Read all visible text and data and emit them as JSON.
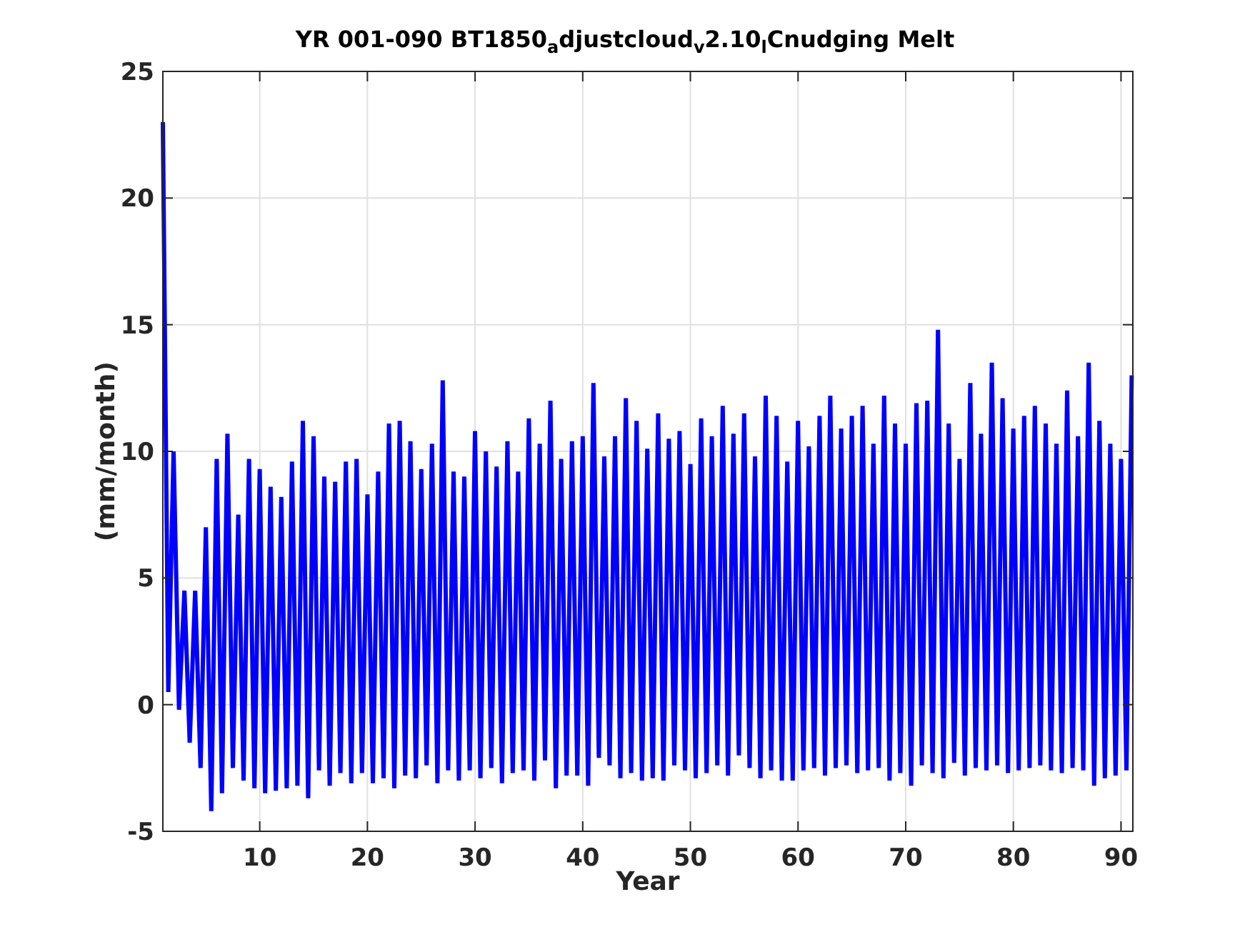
{
  "figure": {
    "chart_data": {
      "type": "line",
      "title": "YR 001-090 BT1850$_{a}$djustcloud$_{v}$2.10$_{l}$Cnudging Melt",
      "xlabel": "Year",
      "ylabel": "(mm/month)",
      "xlim": [
        1,
        91.1
      ],
      "ylim": [
        -5,
        25
      ],
      "xticks": [
        10,
        20,
        30,
        40,
        50,
        60,
        70,
        80,
        90
      ],
      "yticks": [
        25,
        20,
        15,
        10,
        5,
        0,
        -5
      ],
      "grid": true,
      "x": [
        1,
        1.5,
        2,
        2.5,
        3,
        3.5,
        4,
        4.5,
        5,
        5.5,
        6,
        6.5,
        7,
        7.5,
        8,
        8.5,
        9,
        9.5,
        10,
        10.5,
        11,
        11.5,
        12,
        12.5,
        13,
        13.5,
        14,
        14.5,
        15,
        15.5,
        16,
        16.5,
        17,
        17.5,
        18,
        18.5,
        19,
        19.5,
        20,
        20.5,
        21,
        21.5,
        22,
        22.5,
        23,
        23.5,
        24,
        24.5,
        25,
        25.5,
        26,
        26.5,
        27,
        27.5,
        28,
        28.5,
        29,
        29.5,
        30,
        30.5,
        31,
        31.5,
        32,
        32.5,
        33,
        33.5,
        34,
        34.5,
        35,
        35.5,
        36,
        36.5,
        37,
        37.5,
        38,
        38.5,
        39,
        39.5,
        40,
        40.5,
        41,
        41.5,
        42,
        42.5,
        43,
        43.5,
        44,
        44.5,
        45,
        45.5,
        46,
        46.5,
        47,
        47.5,
        48,
        48.5,
        49,
        49.5,
        50,
        50.5,
        51,
        51.5,
        52,
        52.5,
        53,
        53.5,
        54,
        54.5,
        55,
        55.5,
        56,
        56.5,
        57,
        57.5,
        58,
        58.5,
        59,
        59.5,
        60,
        60.5,
        61,
        61.5,
        62,
        62.5,
        63,
        63.5,
        64,
        64.5,
        65,
        65.5,
        66,
        66.5,
        67,
        67.5,
        68,
        68.5,
        69,
        69.5,
        70,
        70.5,
        71,
        71.5,
        72,
        72.5,
        73,
        73.5,
        74,
        74.5,
        75,
        75.5,
        76,
        76.5,
        77,
        77.5,
        78,
        78.5,
        79,
        79.5,
        80,
        80.5,
        81,
        81.5,
        82,
        82.5,
        83,
        83.5,
        84,
        84.5,
        85,
        85.5,
        86,
        86.5,
        87,
        87.5,
        88,
        88.5,
        89,
        89.5,
        90,
        90.5,
        91
      ],
      "series": [
        {
          "color": "#0000ff",
          "values": [
            23,
            0.5,
            10,
            -0.2,
            4.5,
            -1.5,
            4.5,
            -2.5,
            7,
            -4.2,
            9.7,
            -3.5,
            10.7,
            -2.5,
            7.5,
            -3,
            9.7,
            -3.3,
            9.3,
            -3.5,
            8.6,
            -3.4,
            8.2,
            -3.3,
            9.6,
            -3.2,
            11.2,
            -3.7,
            10.6,
            -2.6,
            9,
            -3.2,
            8.8,
            -2.7,
            9.6,
            -3.1,
            9.7,
            -2.7,
            8.3,
            -3.1,
            9.2,
            -2.9,
            11.1,
            -3.3,
            11.2,
            -2.8,
            10.4,
            -2.9,
            9.3,
            -2.4,
            10.3,
            -3.1,
            12.8,
            -2.6,
            9.2,
            -3,
            9,
            -2.6,
            10.8,
            -2.9,
            10,
            -2.5,
            9.4,
            -3.1,
            10.4,
            -2.7,
            9.2,
            -2.6,
            11.3,
            -3,
            10.3,
            -2.2,
            12,
            -3.3,
            9.7,
            -2.8,
            10.4,
            -2.8,
            10.6,
            -3.2,
            12.7,
            -2.1,
            9.8,
            -2.4,
            10.6,
            -2.9,
            12.1,
            -2.7,
            11.2,
            -3,
            10.1,
            -2.9,
            11.5,
            -3,
            10.5,
            -2.4,
            10.8,
            -2.6,
            9.5,
            -2.9,
            11.3,
            -2.7,
            10.6,
            -2.4,
            11.8,
            -2.8,
            10.7,
            -2,
            11.5,
            -2.5,
            9.8,
            -2.9,
            12.2,
            -2.6,
            11.4,
            -3,
            9.6,
            -3,
            11.2,
            -2.6,
            10.2,
            -2.5,
            11.4,
            -2.8,
            12.2,
            -2.5,
            10.9,
            -2.4,
            11.4,
            -2.7,
            11.8,
            -2.6,
            10.3,
            -2.5,
            12.2,
            -3,
            11.1,
            -2.7,
            10.3,
            -3.2,
            11.9,
            -2.4,
            12,
            -2.7,
            14.8,
            -2.9,
            11.1,
            -2.3,
            9.7,
            -2.8,
            12.7,
            -2.5,
            10.7,
            -2.6,
            13.5,
            -2.4,
            12.1,
            -2.7,
            10.9,
            -2.6,
            11.4,
            -2.5,
            11.8,
            -2.4,
            11.1,
            -2.6,
            10.3,
            -2.7,
            12.4,
            -2.5,
            10.6,
            -2.6,
            13.5,
            -3.2,
            11.2,
            -2.9,
            10.3,
            -2.8,
            9.7,
            -2.6,
            13
          ]
        }
      ]
    }
  }
}
